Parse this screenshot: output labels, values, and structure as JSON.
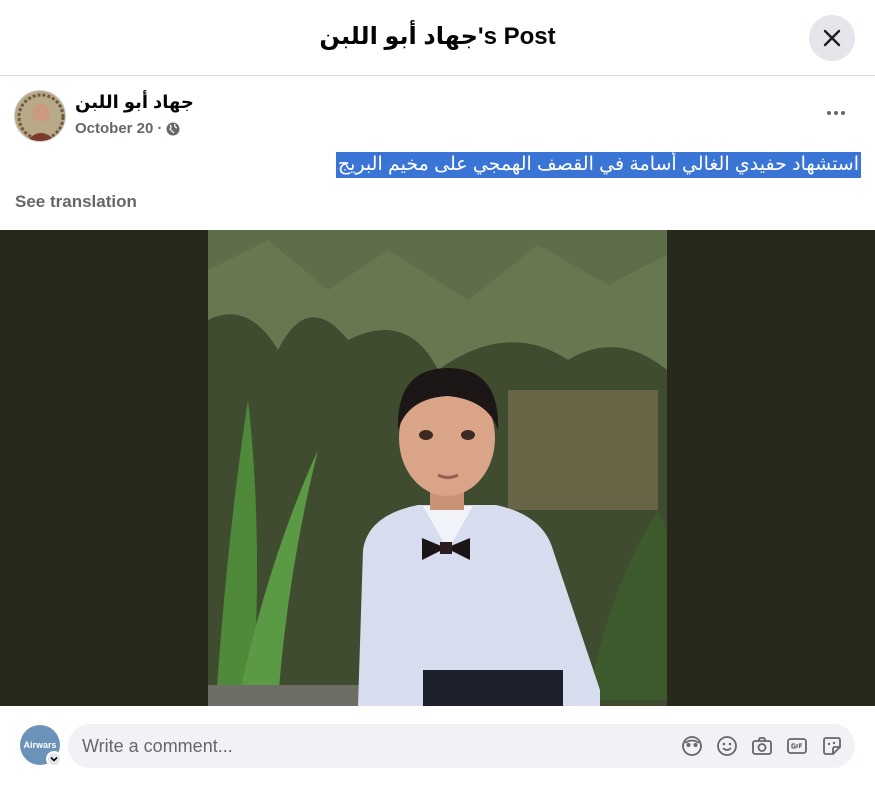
{
  "header": {
    "title": "جهاد أبو اللبن's Post"
  },
  "post": {
    "author": "جهاد أبو اللبن",
    "date": "October 20",
    "separator": "·",
    "text": "استشهاد حفيدي الغالي أسامة في القصف الهمجي على مخيم البريج",
    "see_translation": "See translation"
  },
  "comment": {
    "avatar_text": "Airwars",
    "placeholder": "Write a comment..."
  },
  "icons": {
    "close": "close-icon",
    "globe": "globe-icon",
    "more": "more-icon",
    "avatar_switch": "chevron-down-icon",
    "tools": [
      "avatar-sticker-icon",
      "emoji-icon",
      "camera-icon",
      "gif-icon",
      "sticker-icon"
    ]
  },
  "colors": {
    "selection": "#3a74d5",
    "secondary_text": "#65676b",
    "button_bg": "#e4e6eb",
    "media_bg": "#27291c"
  }
}
